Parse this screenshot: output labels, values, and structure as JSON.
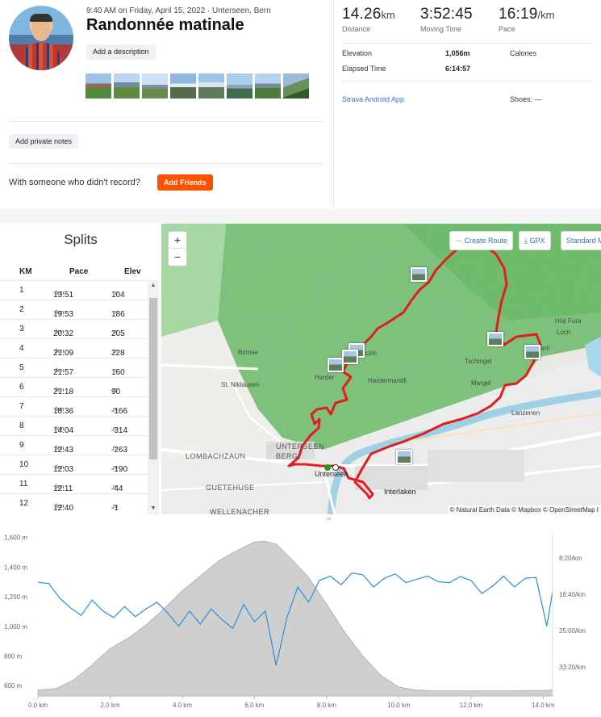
{
  "activity": {
    "meta": "9:40 AM on Friday, April 15, 2022 · Unterseen, Bern",
    "title": "Randonnée matinale",
    "add_description": "Add a description",
    "add_private_notes": "Add private notes",
    "with_someone": "With someone who didn't record?",
    "add_friends": "Add Friends"
  },
  "stats": {
    "distance": {
      "value": "14.26",
      "unit": "km",
      "label": "Distance"
    },
    "moving_time": {
      "value": "3:52:45",
      "label": "Moving Time"
    },
    "pace": {
      "value": "16:19",
      "unit": "/km",
      "label": "Pace"
    },
    "elevation_label": "Elevation",
    "elevation_value": "1,056m",
    "calories_label": "Calories",
    "elapsed_label": "Elapsed Time",
    "elapsed_value": "6:14:57",
    "device": "Strava Android App",
    "shoes_label": "Shoes: —"
  },
  "splits": {
    "title": "Splits",
    "headers": [
      "KM",
      "Pace",
      "Elev"
    ],
    "pace_unit": "/km",
    "elev_unit": "m",
    "rows": [
      {
        "km": "1",
        "pace": "13:51",
        "elev": "104"
      },
      {
        "km": "2",
        "pace": "19:53",
        "elev": "186"
      },
      {
        "km": "3",
        "pace": "20:32",
        "elev": "205"
      },
      {
        "km": "4",
        "pace": "21:09",
        "elev": "228"
      },
      {
        "km": "5",
        "pace": "21:57",
        "elev": "160"
      },
      {
        "km": "6",
        "pace": "21:18",
        "elev": "90"
      },
      {
        "km": "7",
        "pace": "18:36",
        "elev": "-166"
      },
      {
        "km": "8",
        "pace": "14:04",
        "elev": "-314"
      },
      {
        "km": "9",
        "pace": "12:43",
        "elev": "-263"
      },
      {
        "km": "10",
        "pace": "12:03",
        "elev": "-190"
      },
      {
        "km": "11",
        "pace": "12:11",
        "elev": "-44"
      },
      {
        "km": "12",
        "pace": "12:40",
        "elev": "-1"
      }
    ]
  },
  "map": {
    "zoom_in": "+",
    "zoom_out": "−",
    "create_route": "Create Route",
    "gpx": "GPX",
    "standard": "Standard M",
    "attribution": "© Natural Earth Data © Mapbox © OpenStreetMap I",
    "places": {
      "birmse": "Birmse",
      "niklausen": "St. Niklausen",
      "harder": "Hardermandli",
      "harderk": "Harder",
      "kulm": "kulm",
      "margel": "Margel",
      "tschingel": "Tschingel",
      "holi": "Höji Fura",
      "loch": "Loch",
      "lanzenen": "Lanzenen",
      "unterseen": "Unterseen",
      "unterseen_big": "UNTERSEEN",
      "beg": "BERG",
      "interlaken": "Interlaken",
      "lombach": "LOMBACHZAUN",
      "guetehuse": "GUETEHUSE",
      "wellenacher": "WELLENACHER",
      "arti": "arti"
    }
  },
  "chart_data": {
    "type": "area",
    "x_ticks": [
      "0.0 km",
      "2.0 km",
      "4.0 km",
      "6.0 km",
      "8.0 km",
      "10.0 km",
      "12.0 km",
      "14.0 km"
    ],
    "y_left_ticks": [
      "600 m",
      "800 m",
      "1,000 m",
      "1,200 m",
      "1,400 m",
      "1,600 m"
    ],
    "y_right_ticks": [
      "8:20/km",
      "16:40/km",
      "25:00/km",
      "33:20/km"
    ],
    "xlim": [
      0,
      14.26
    ],
    "ylim": [
      530,
      1620
    ],
    "series": [
      {
        "x": [
          0,
          0.5,
          1.0,
          1.5,
          2.0,
          2.5,
          3.0,
          3.5,
          4.0,
          4.5,
          5.0,
          5.5,
          6.0,
          6.3,
          6.6,
          7.0,
          7.5,
          8.0,
          8.5,
          9.0,
          9.5,
          10.0,
          10.5,
          11.0,
          12.0,
          13.0,
          14.0,
          14.26
        ],
        "values": [
          570,
          580,
          640,
          740,
          850,
          920,
          1010,
          1120,
          1240,
          1340,
          1440,
          1510,
          1570,
          1575,
          1555,
          1460,
          1330,
          1150,
          960,
          800,
          670,
          590,
          570,
          565,
          565,
          565,
          568,
          570
        ]
      },
      {
        "x": [
          0,
          0.3,
          0.6,
          0.9,
          1.2,
          1.5,
          1.8,
          2.1,
          2.4,
          2.7,
          3.0,
          3.3,
          3.6,
          3.9,
          4.2,
          4.5,
          4.8,
          5.1,
          5.4,
          5.7,
          6.0,
          6.3,
          6.6,
          6.9,
          7.2,
          7.5,
          7.8,
          8.1,
          8.4,
          8.7,
          9.0,
          9.3,
          9.6,
          9.9,
          10.2,
          10.5,
          10.8,
          11.1,
          11.4,
          11.7,
          12.0,
          12.3,
          12.6,
          12.9,
          13.2,
          13.5,
          13.8,
          14.1,
          14.26
        ],
        "values": [
          13.9,
          14.2,
          17.5,
          19.8,
          21.5,
          18.0,
          20.5,
          22.0,
          19.5,
          21.8,
          20.0,
          18.5,
          21.0,
          24.0,
          20.5,
          23.5,
          20.0,
          22.5,
          24.5,
          19.0,
          23.0,
          20.5,
          33.0,
          22.0,
          15.0,
          18.5,
          13.5,
          12.5,
          14.5,
          11.8,
          12.2,
          15.0,
          13.0,
          12.0,
          14.0,
          13.2,
          12.5,
          13.8,
          14.0,
          12.6,
          13.5,
          16.5,
          14.8,
          12.5,
          15.0,
          13.0,
          12.8,
          24.0,
          16.0
        ]
      }
    ]
  }
}
